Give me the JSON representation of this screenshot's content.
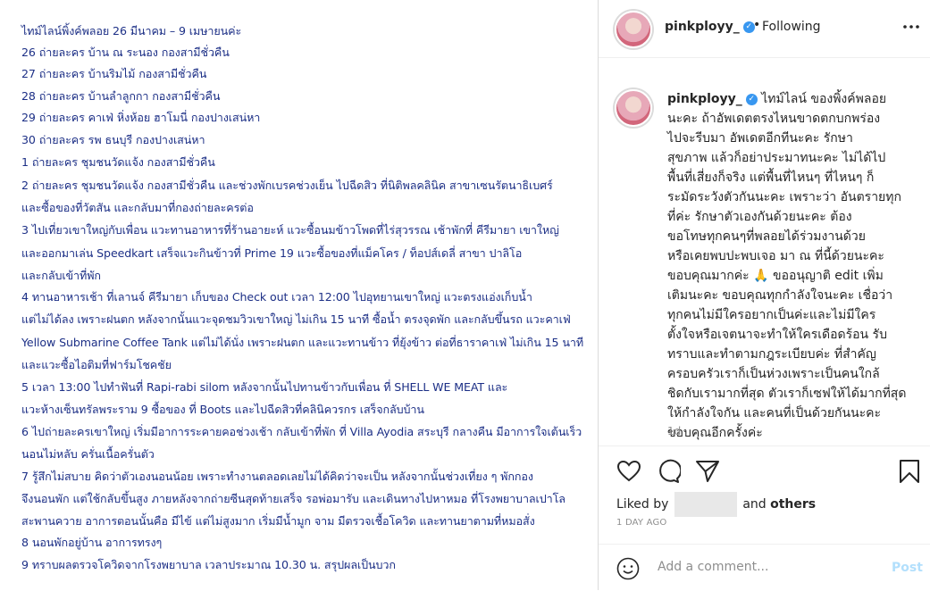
{
  "post_image": {
    "lines": [
      "ไทม์ไลน์พิ้งค์พลอย 26 มีนาคม – 9 เมษายนค่ะ",
      "26 ถ่ายละคร บ้าน ณ ระนอง กองสามีชั่วคืน",
      "27 ถ่ายละคร บ้านริมไม้ กองสามีชั่วคืน",
      "28 ถ่ายละคร บ้านลำลูกกา กองสามีชั่วคืน",
      "29 ถ่ายละคร คาเฟ่ หิ่งห้อย ฮาโมนี่ กองปางเสน่หา",
      "30 ถ่ายละคร รพ ธนบุรี กองปางเสน่หา",
      "1 ถ่ายละคร ชุมชนวัดแจ้ง กองสามีชั่วคืน",
      "2 ถ่ายละคร ชุมชนวัดแจ้ง กองสามีชั่วคืน และช่วงพักเบรคช่วงเย็น ไปฉีดสิว ที่นิติพลคลินิค สาขาเซนรัตนาธิเบศร์",
      "และซื้อของที่วัตสัน และกลับมาที่กองถ่ายละครต่อ",
      "3 ไปเที่ยวเขาใหญ่กับเพื่อน แวะทานอาหารที่ร้านอายะห์ แวะซื้อนมข้าวโพดที่ไร่สุวรรณ เช้าพักที่ คีรีมายา เขาใหญ่",
      "และออกมาเล่น Speedkart เสร็จแวะกินข้าวที่ Prime 19 แวะซื้อของที่แม็คโคร / ท็อปส์เดลี่ สาขา ปาลิโอ",
      "และกลับเข้าที่พัก",
      "4 ทานอาหารเช้า ที่เลานจ์ คีรีมายา เก็บของ Check out เวลา 12:00 ไปอุทยานเขาใหญ่ แวะตรงแอ่งเก็บน้ำ",
      "แต่ไม่ได้ลง เพราะฝนตก หลังจากนั้นแวะจุดชมวิวเขาใหญ่ ไม่เกิน 15 นาที ซื้อน้ำ ตรงจุดพัก และกลับขึ้นรถ แวะคาเฟ่",
      "Yellow Submarine Coffee Tank แต่ไม่ได้นั่ง เพราะฝนตก และแวะทานข้าว ที่ยุ้งข้าว ต่อที่ธาราคาเฟ่ ไม่เกิน 15 นาที",
      "และแวะซื้อไอติมที่ฟาร์มโชคชัย",
      "5 เวลา 13:00 ไปทำฟันที่ Rapi-rabi silom หลังจากนั้นไปทานข้าวกับเพื่อน ที่ SHELL WE MEAT และ",
      "แวะห้างเซ็นทรัลพระราม 9 ซื้อของ ที่ Boots และไปฉีดสิวที่คลินิควรกร เสร็จกลับบ้าน",
      "6 ไปถ่ายละครเขาใหญ่ เริ่มมีอาการระคายคอช่วงเช้า กลับเข้าที่พัก ที่ Villa Ayodia สระบุรี กลางคืน มีอาการใจเต้นเร็ว",
      "นอนไม่หลับ ครั่นเนื้อครั่นตัว",
      "7 รู้สึกไม่สบาย คิดว่าตัวเองนอนน้อย เพราะทำงานตลอดเลยไม่ได้คิดว่าจะเป็น หลังจากนั้นช่วงเที่ยง ๆ พักกอง",
      "จึงนอนพัก แต่ใช้กลับขึ้นสูง ภายหลังจากถ่ายซีนสุดท้ายเสร็จ รอพ่อมารับ และเดินทางไปหาหมอ ที่โรงพยาบาลเปาโล",
      "สะพานควาย อาการตอนนั้นคือ มีไข้ แต่ไม่สูงมาก เริ่มมีน้ำมูก จาม มีตรวจเชื้อโควิด และทานยาตามที่หมอสั่ง",
      "8 นอนพักอยู่บ้าน อาการทรงๆ",
      "9 ทราบผลตรวจโควิดจากโรงพยาบาล เวลาประมาณ 10.30 น. สรุปผลเป็นบวก"
    ]
  },
  "header": {
    "username": "pinkployy_",
    "dot": "•",
    "following": "Following",
    "more_icon": "more-icon"
  },
  "caption": {
    "username": "pinkployy_",
    "lines": [
      " ไทม์ไลน์ ของพิ้งค์พลอย",
      "นะคะ ถ้าอัพเดตตรงไหนขาดตกบกพร่อง",
      "ไปจะรีบมา อัพเดตอีกทีนะคะ รักษา",
      "สุขภาพ แล้วก็อย่าประมาทนะคะ ไม่ได้ไป",
      "พื้นที่เสี่ยงก็จริง แต่พื้นที่ไหนๆ ที่ไหนๆ ก็",
      "ระมัดระวังตัวกันนะคะ เพราะว่า อันตรายทุก",
      "ที่ค่ะ รักษาตัวเองกันด้วยนะคะ ต้อง",
      "ขอโทษทุกคนๆที่พลอยได้ร่วมงานด้วย",
      "หรือเคยพบปะพบเจอ มา ณ ที่นี้ด้วยนะคะ",
      "ขอบคุณมากค่ะ 🙏 ขออนุญาติ edit เพิ่ม",
      "เติมนะคะ ขอบคุณทุกกำลังใจนะคะ เชื่อว่า",
      "ทุกคนไม่มีใครอยากเป็นค่ะและไม่มีใคร",
      "ตั้งใจหรือเจตนาจะทำให้ใครเดือดร้อน รับ",
      "ทราบและทำตามกฎระเบียบค่ะ ที่สำคัญ",
      "ครอบครัวเราก็เป็นห่วงเพราะเป็นคนใกล้",
      "ชิดกับเรามากที่สุด ตัวเราก็เซฟให้ได้มากที่สุด",
      "ให้กำลังใจกัน และคนที่เป็นด้วยกันนะคะ",
      "ขอบคุณอีกครั้งค่ะ"
    ],
    "time": "1d"
  },
  "actions": {
    "like_icon": "heart-icon",
    "comment_icon": "comment-icon",
    "share_icon": "share-icon",
    "save_icon": "bookmark-icon",
    "liked_by": "Liked by",
    "and": "and",
    "others": "others",
    "date": "1 DAY AGO"
  },
  "comment": {
    "placeholder": "Add a comment...",
    "post_label": "Post"
  },
  "colors": {
    "image_text": "#1c2f86",
    "verified": "#3897f0",
    "post_button_disabled": "#b2dffc"
  }
}
